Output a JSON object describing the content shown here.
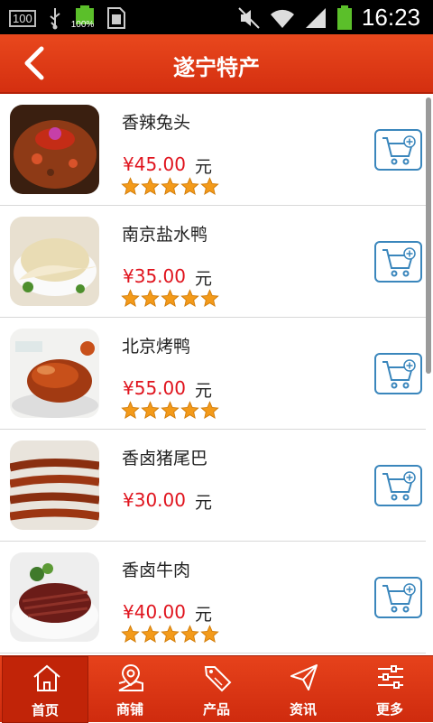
{
  "status_bar": {
    "battery_left_text": "100",
    "battery_pct": "100%",
    "time": "16:23"
  },
  "header": {
    "title": "遂宁特产"
  },
  "products": [
    {
      "name": "香辣兔头",
      "price": "¥45.00",
      "unit": "元",
      "stars": 5
    },
    {
      "name": "南京盐水鸭",
      "price": "¥35.00",
      "unit": "元",
      "stars": 5
    },
    {
      "name": "北京烤鸭",
      "price": "¥55.00",
      "unit": "元",
      "stars": 5
    },
    {
      "name": "香卤猪尾巴",
      "price": "¥30.00",
      "unit": "元",
      "stars": 0
    },
    {
      "name": "香卤牛肉",
      "price": "¥40.00",
      "unit": "元",
      "stars": 5
    }
  ],
  "tabs": [
    {
      "label": "首页",
      "icon": "home-icon",
      "active": true
    },
    {
      "label": "商铺",
      "icon": "shop-map-icon",
      "active": false
    },
    {
      "label": "产品",
      "icon": "sale-tag-icon",
      "active": false
    },
    {
      "label": "资讯",
      "icon": "paper-plane-icon",
      "active": false
    },
    {
      "label": "更多",
      "icon": "sliders-icon",
      "active": false
    }
  ],
  "colors": {
    "header_red": "#e3411b",
    "price_red": "#e0141e",
    "cart_blue": "#3a86bc",
    "star_orange": "#f39a1a"
  }
}
